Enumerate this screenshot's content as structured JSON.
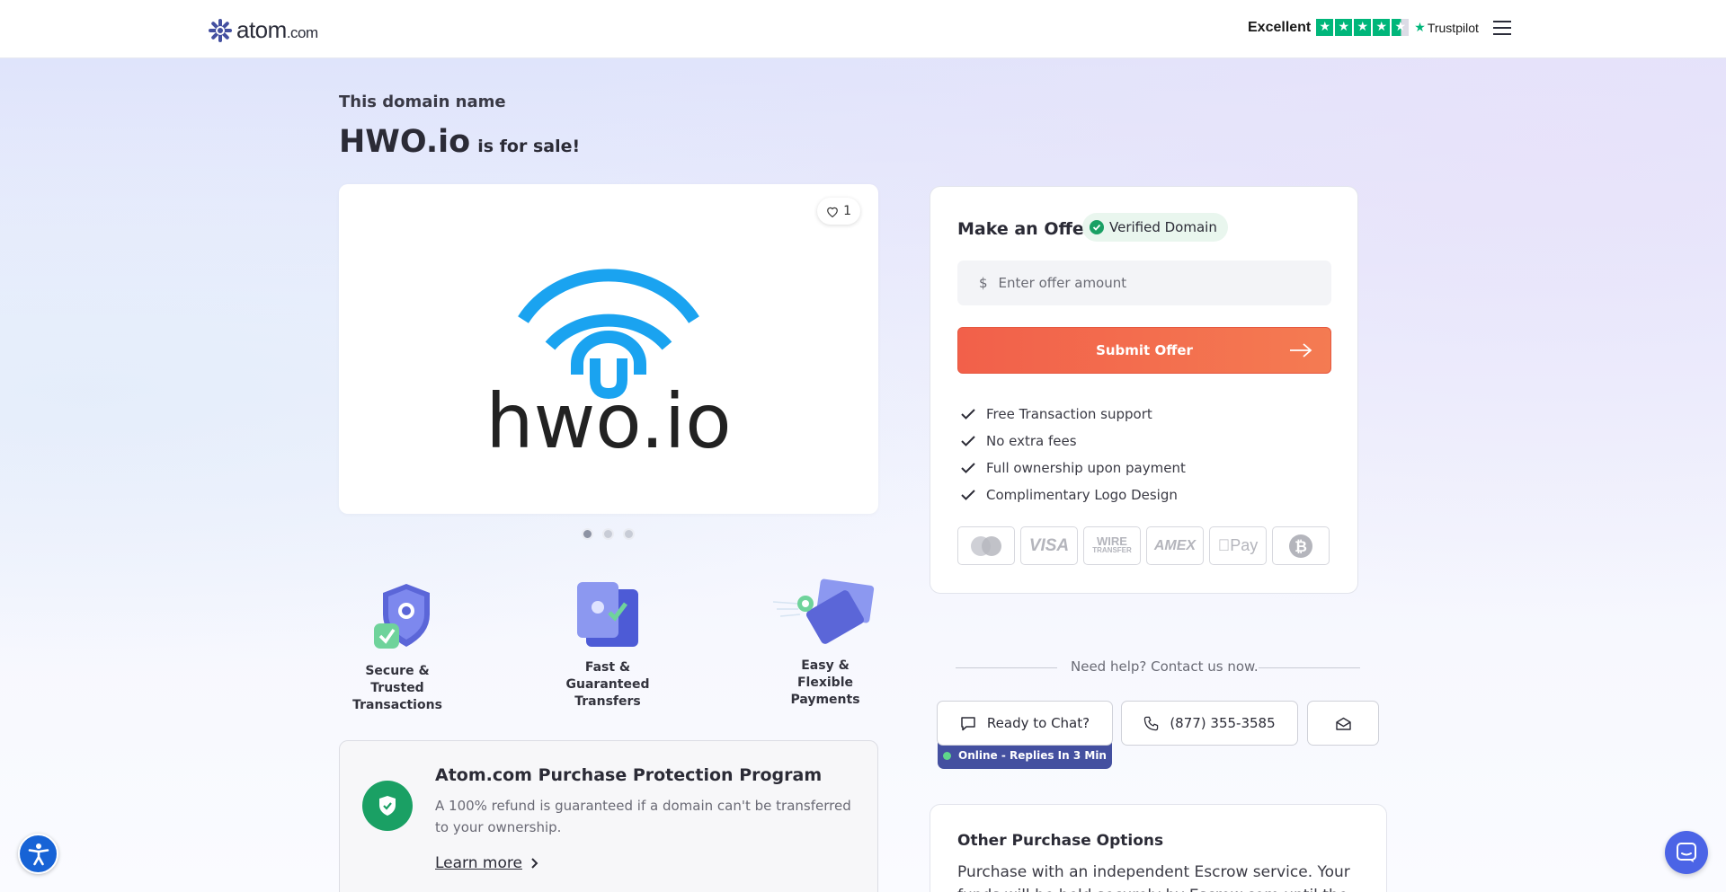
{
  "header": {
    "logo_text": "atom",
    "logo_suffix": ".com",
    "trustpilot_rating": "Excellent",
    "trustpilot_brand": "Trustpilot"
  },
  "hero": {
    "eyebrow": "This domain name",
    "domain": "HWO.io",
    "for_sale": "is for sale!"
  },
  "logo_card": {
    "likes": "1",
    "logo_wordmark": "hwo.io",
    "carousel": {
      "total": 3,
      "active": 1
    }
  },
  "features": [
    {
      "label": "Secure & Trusted Transactions",
      "icon": "shield-icon"
    },
    {
      "label": "Fast & Guaranteed Transfers",
      "icon": "wallet-icon"
    },
    {
      "label": "Easy & Flexible Payments",
      "icon": "cards-icon"
    }
  ],
  "protection": {
    "title": "Atom.com Purchase Protection Program",
    "text": "A 100% refund is guaranteed if a domain can't be transferred to your ownership.",
    "link": "Learn more"
  },
  "offer": {
    "title": "Make an Offer",
    "verified": "Verified Domain",
    "currency": "$",
    "placeholder": "Enter offer amount",
    "submit": "Submit Offer",
    "benefits": [
      "Free Transaction support",
      "No extra fees",
      "Full ownership upon payment",
      "Complimentary Logo Design"
    ],
    "payments": [
      "mastercard-icon",
      "visa-icon",
      "wire-transfer-icon",
      "amex-icon",
      "apple-pay-icon",
      "bitcoin-icon"
    ],
    "payment_labels": {
      "visa": "VISA",
      "wire_1": "WIRE",
      "wire_2": "TRANSFER",
      "amex": "AMEX",
      "applepay": "Pay"
    }
  },
  "help": {
    "text": "Need help? Contact us now.",
    "chat": "Ready to Chat?",
    "online": "Online - Replies In 3 Min",
    "phone": "(877) 355-3585"
  },
  "other": {
    "title": "Other Purchase Options",
    "text": "Purchase with an independent Escrow service. Your funds will be held securely by Escrow.com until the domain is"
  },
  "colors": {
    "accent": "#f2604a",
    "brand": "#4450a0",
    "success": "#1aa064",
    "logo_blue": "#1aa3f0",
    "trustpilot": "#00b67a"
  }
}
